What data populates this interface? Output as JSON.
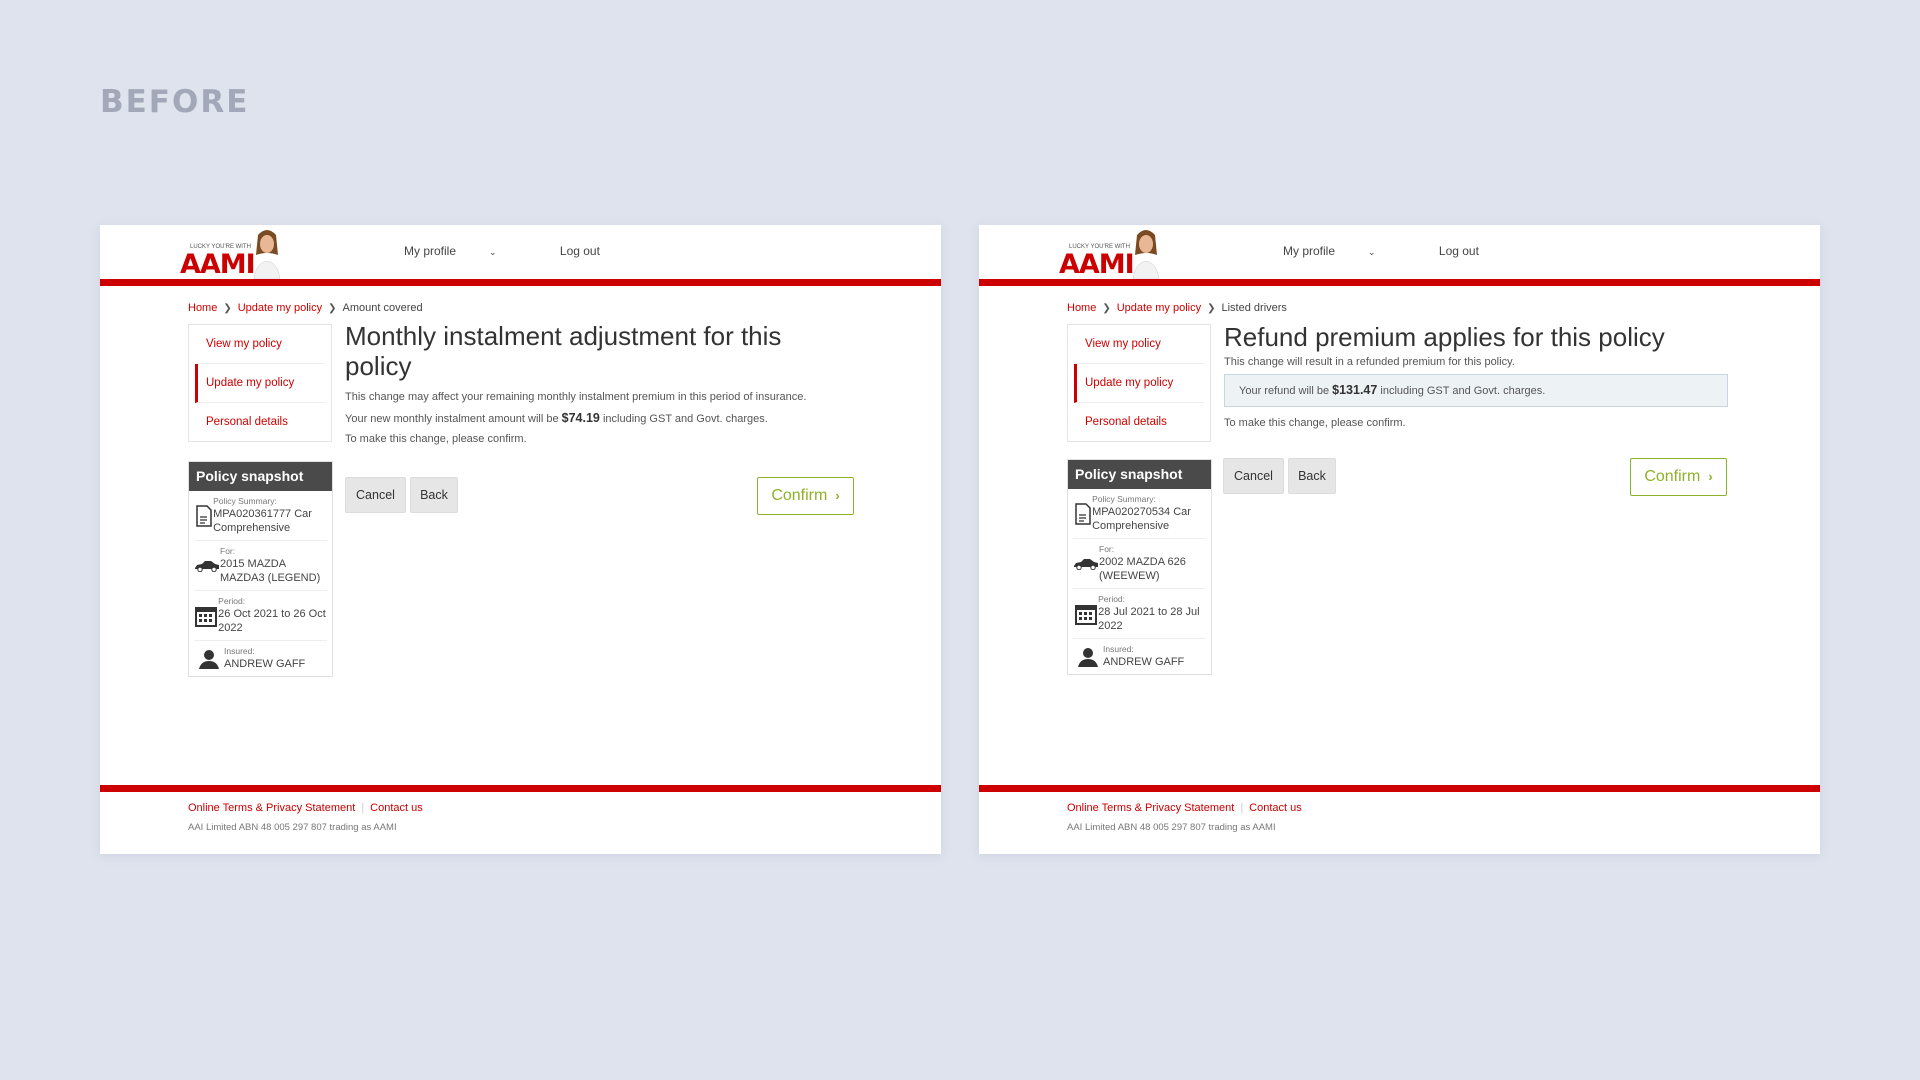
{
  "heading": "BEFORE",
  "colors": {
    "brand_red": "#cc0000",
    "confirm_green": "#8db229",
    "snapshot_header": "#4a4a4a",
    "background": "#dfe3ee"
  },
  "screens": [
    {
      "header": {
        "logo_tagline": "LUCKY YOU'RE WITH",
        "logo_text": "AAMI",
        "nav": [
          "My profile",
          "Log out"
        ]
      },
      "breadcrumb": [
        "Home",
        "Update my policy",
        "Amount covered"
      ],
      "menu": [
        "View my policy",
        "Update my policy",
        "Personal details"
      ],
      "snapshot": {
        "title": "Policy snapshot",
        "summary_label": "Policy Summary:",
        "summary_value": "MPA020361777 Car Comprehensive",
        "for_label": "For:",
        "for_value": "2015 MAZDA MAZDA3 (LEGEND)",
        "period_label": "Period:",
        "period_value": "26 Oct 2021 to 26 Oct 2022",
        "insured_label": "Insured:",
        "insured_value": "ANDREW GAFF"
      },
      "title": "Monthly instalment adjustment for this policy",
      "line1": "This change may affect your remaining monthly instalment premium in this period of insurance.",
      "line2_pre": "Your new monthly instalment amount will be ",
      "line2_amount": "$74.19",
      "line2_post": " including GST and Govt. charges.",
      "line3": "To make this change, please confirm.",
      "buttons": {
        "cancel": "Cancel",
        "back": "Back",
        "confirm": "Confirm"
      },
      "footer": {
        "terms": "Online Terms & Privacy Statement",
        "contact": "Contact us",
        "abn": "AAI Limited ABN 48 005 297 807 trading as AAMI"
      }
    },
    {
      "header": {
        "logo_tagline": "LUCKY YOU'RE WITH",
        "logo_text": "AAMI",
        "nav": [
          "My profile",
          "Log out"
        ]
      },
      "breadcrumb": [
        "Home",
        "Update my policy",
        "Listed drivers"
      ],
      "menu": [
        "View my policy",
        "Update my policy",
        "Personal details"
      ],
      "snapshot": {
        "title": "Policy snapshot",
        "summary_label": "Policy Summary:",
        "summary_value": "MPA020270534 Car Comprehensive",
        "for_label": "For:",
        "for_value": "2002 MAZDA 626 (WEEWEW)",
        "period_label": "Period:",
        "period_value": "28 Jul 2021 to 28 Jul 2022",
        "insured_label": "Insured:",
        "insured_value": "ANDREW GAFF"
      },
      "title": "Refund premium applies for this policy",
      "line1": "This change will result in a refunded premium for this policy.",
      "refund_pre": "Your refund will be ",
      "refund_amount": "$131.47",
      "refund_post": " including GST and Govt. charges.",
      "line3": "To make this change, please confirm.",
      "buttons": {
        "cancel": "Cancel",
        "back": "Back",
        "confirm": "Confirm"
      },
      "footer": {
        "terms": "Online Terms & Privacy Statement",
        "contact": "Contact us",
        "abn": "AAI Limited ABN 48 005 297 807 trading as AAMI"
      }
    }
  ]
}
